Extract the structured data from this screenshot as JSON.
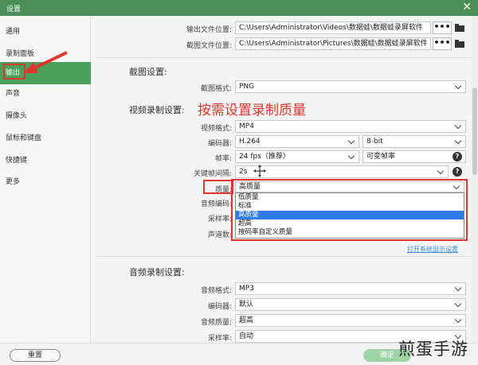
{
  "window": {
    "title": "设置",
    "close_glyph": "✕"
  },
  "sidebar": {
    "items": [
      {
        "label": "通用",
        "active": false
      },
      {
        "label": "录制面板",
        "active": false
      },
      {
        "label": "输出",
        "active": true
      },
      {
        "label": "声音",
        "active": false
      },
      {
        "label": "摄像头",
        "active": false
      },
      {
        "label": "鼠标和键盘",
        "active": false
      },
      {
        "label": "快捷键",
        "active": false
      },
      {
        "label": "更多",
        "active": false
      }
    ]
  },
  "output": {
    "output_location_label": "输出文件位置:",
    "output_location_value": "C:\\Users\\Administrator\\Videos\\数据蛙\\数据蛙录屏软件",
    "screenshot_location_label": "截图文件位置:",
    "screenshot_location_value": "C:\\Users\\Administrator\\Pictures\\数据蛙\\数据蛙录屏软件",
    "browse_label": "•••"
  },
  "screenshot_settings": {
    "section_title": "截图设置:",
    "format_label": "截图格式:",
    "format_value": "PNG"
  },
  "video_settings": {
    "section_title": "视频录制设置:",
    "annotation": "按需设置录制质量",
    "format_label": "视频格式:",
    "format_value": "MP4",
    "encoder_label": "编码器:",
    "encoder_value": "H.264",
    "bitdepth_value": "8-bit",
    "framerate_label": "帧率:",
    "framerate_value": "24 fps（推荐）",
    "framerate_mode_value": "可变帧率",
    "keyframe_label": "关键帧间隔:",
    "keyframe_value": "2s",
    "quality_label": "质量:",
    "quality_value": "高质量",
    "quality_options": [
      {
        "label": "低质量",
        "selected": false
      },
      {
        "label": "标准",
        "selected": false
      },
      {
        "label": "高质量",
        "selected": true
      },
      {
        "label": "超高",
        "selected": false
      },
      {
        "label": "按码率自定义质量",
        "selected": false
      }
    ],
    "audio_codec_label": "音频编码:",
    "sample_rate_label": "采样率:",
    "channels_label": "声道数:",
    "system_settings_link": "打开系统显示设置",
    "help_glyph": "?"
  },
  "audio_settings": {
    "section_title": "音频录制设置:",
    "format_label": "音频格式:",
    "format_value": "MP3",
    "encoder_label": "编码器:",
    "encoder_value": "默认",
    "quality_label": "音频质量:",
    "quality_value": "超高",
    "sample_rate_label": "采样率:",
    "sample_rate_value": "自动"
  },
  "footer": {
    "reset_label": "重置",
    "ok_label": "确定"
  },
  "watermark": "煎蛋手游",
  "colors": {
    "accent_green": "#4aa05c",
    "annotation_red": "#e0362c",
    "selection_blue": "#2f7ae5"
  }
}
